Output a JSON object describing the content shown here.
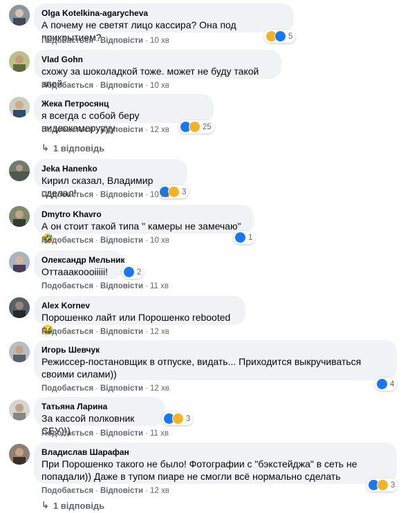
{
  "ui": {
    "like_label": "Подобається",
    "reply_label": "Відповісти",
    "dot": "·"
  },
  "comments": [
    {
      "author": "Olga Kotelkina-agarycheva",
      "text": "А почему не светят лицо кассира? Она под прикрытием?",
      "time": "10 хв",
      "reactions": [
        "haha",
        "like"
      ],
      "count": "5"
    },
    {
      "author": "Vlad Gohn",
      "text": "схожу за шоколадкой тоже. может не буду такой злой",
      "time": "10 хв",
      "reactions": [],
      "count": ""
    },
    {
      "author": "Жека Петросянц",
      "text": "я всегда с собой беру видеокамеруууу",
      "time": "12 хв",
      "reactions": [
        "like",
        "haha"
      ],
      "count": "25",
      "replies": "1 відповідь"
    },
    {
      "author": "Jeka Hanenko",
      "text": "Кирил сказал, Владимир сделал!",
      "time": "10 хв",
      "reactions": [
        "like",
        "haha"
      ],
      "count": "3"
    },
    {
      "author": "Dmytro Khavro",
      "text": "А он стоит такой типа \" камеры не замечаю\" 🤣",
      "time": "10 хв",
      "reactions": [
        "like"
      ],
      "count": "1"
    },
    {
      "author": "Олександр Мельник",
      "text": "Оттааакоооііііі!",
      "time": "11 хв",
      "reactions": [
        "like"
      ],
      "count": "2"
    },
    {
      "author": "Alex Kornev",
      "text": "Порошенко лайт или Порошенко rebooted 😂",
      "time": "12 хв",
      "reactions": [],
      "count": ""
    },
    {
      "author": "Игорь Шевчук",
      "text": "Режиссер-постановщик в отпуске, видать... Приходится выкручиваться своими силами))",
      "time": "12 хв",
      "reactions": [
        "like"
      ],
      "count": "4"
    },
    {
      "author": "Татьяна Ларина",
      "text": "За кассой полковник СБУ)))",
      "time": "11 хв",
      "reactions": [
        "like",
        "haha"
      ],
      "count": "3"
    },
    {
      "author": "Владислав Шарафан",
      "text": "При Порошенко такого не было! Фотографии с \"бэкстейджа\" в сеть не попадали)) Даже в тупом пиаре не смогли всё нормально сделать",
      "time": "12 хв",
      "reactions": [
        "like",
        "haha"
      ],
      "count": "3",
      "replies": "1 відповідь"
    }
  ],
  "colors": {
    "like": "#1877f2",
    "haha": "#f7b125",
    "bubble": "#f0f2f5",
    "meta": "#65676b"
  }
}
